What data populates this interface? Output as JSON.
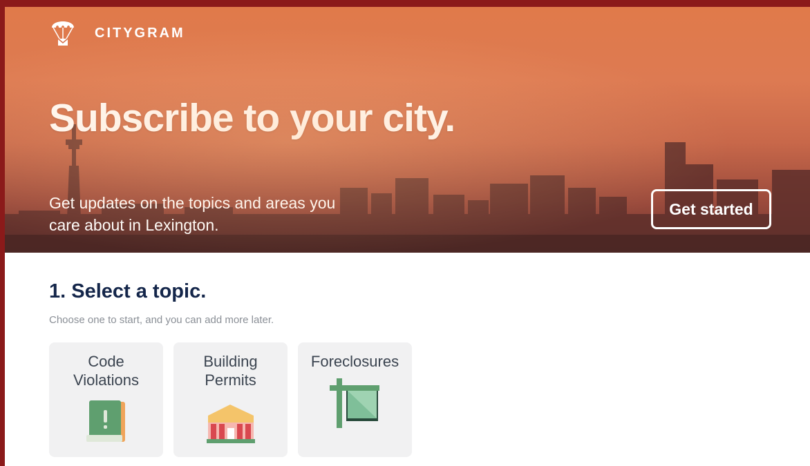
{
  "app": {
    "brand": "CITYGRAM",
    "logo_icon": "parachute-mail-icon"
  },
  "hero": {
    "headline": "Subscribe to your city.",
    "subtext": "Get updates on the topics and areas you care about in Lexington.",
    "cta_label": "Get started"
  },
  "topics": {
    "title": "1. Select a topic.",
    "subtitle": "Choose one to start, and you can add more later.",
    "items": [
      {
        "label": "Code Violations",
        "icon": "code-violation-book-icon"
      },
      {
        "label": "Building Permits",
        "icon": "building-icon"
      },
      {
        "label": "Foreclosures",
        "icon": "for-sale-sign-icon"
      }
    ]
  },
  "colors": {
    "frame": "#8b1a1a",
    "title": "#14264a",
    "card_bg": "#f1f1f2"
  }
}
